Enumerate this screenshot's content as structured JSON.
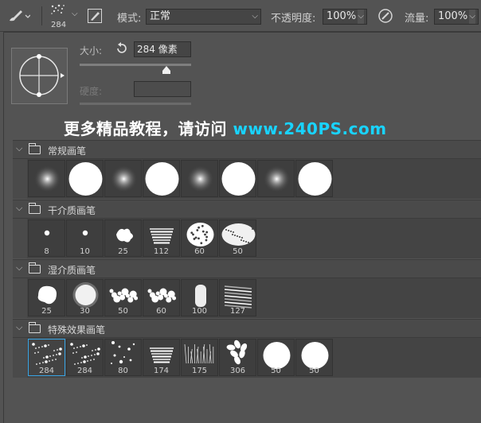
{
  "toolbar": {
    "brush_size": "284",
    "mode_label": "模式:",
    "mode_value": "正常",
    "opacity_label": "不透明度:",
    "opacity_value": "100%",
    "flow_label": "流量:",
    "flow_value": "100%"
  },
  "panel": {
    "size_label": "大小:",
    "size_value": "284 像素",
    "size_slider_fraction": 0.78,
    "hardness_label": "硬度:",
    "hardness_value": ""
  },
  "banner": {
    "text": "更多精品教程，请访问",
    "url": "www.240PS.com"
  },
  "groups": [
    {
      "name": "常规画笔",
      "brushes": [
        {
          "kind": "soft",
          "label": ""
        },
        {
          "kind": "hard",
          "label": ""
        },
        {
          "kind": "soft",
          "label": ""
        },
        {
          "kind": "hard",
          "label": ""
        },
        {
          "kind": "soft",
          "label": ""
        },
        {
          "kind": "hard",
          "label": ""
        },
        {
          "kind": "soft",
          "label": ""
        },
        {
          "kind": "hard",
          "label": ""
        }
      ]
    },
    {
      "name": "干介质画笔",
      "brushes": [
        {
          "kind": "dot-small",
          "label": "8"
        },
        {
          "kind": "dot-small",
          "label": "10"
        },
        {
          "kind": "splat",
          "label": "25"
        },
        {
          "kind": "stroke-rough",
          "label": "112"
        },
        {
          "kind": "blob-texture",
          "label": "60"
        },
        {
          "kind": "oval-texture",
          "label": "50"
        }
      ]
    },
    {
      "name": "湿介质画笔",
      "brushes": [
        {
          "kind": "blob",
          "label": "25"
        },
        {
          "kind": "fuzzy",
          "label": "30"
        },
        {
          "kind": "smear",
          "label": "50"
        },
        {
          "kind": "smear",
          "label": "60"
        },
        {
          "kind": "bar",
          "label": "100"
        },
        {
          "kind": "streaks",
          "label": "127"
        }
      ]
    },
    {
      "name": "特殊效果画笔",
      "brushes": [
        {
          "kind": "spray",
          "label": "284",
          "selected": true
        },
        {
          "kind": "spray",
          "label": "284"
        },
        {
          "kind": "dots",
          "label": "80"
        },
        {
          "kind": "stroke-rough",
          "label": "174"
        },
        {
          "kind": "grass",
          "label": "175"
        },
        {
          "kind": "leaves",
          "label": "306"
        },
        {
          "kind": "hard",
          "label": "50"
        },
        {
          "kind": "hard",
          "label": "50"
        }
      ]
    }
  ],
  "colors": {
    "panel_bg": "#535353",
    "tile_bg": "#3e3e3e",
    "selection": "#38a5e6",
    "banner_url": "#19d3ff"
  }
}
